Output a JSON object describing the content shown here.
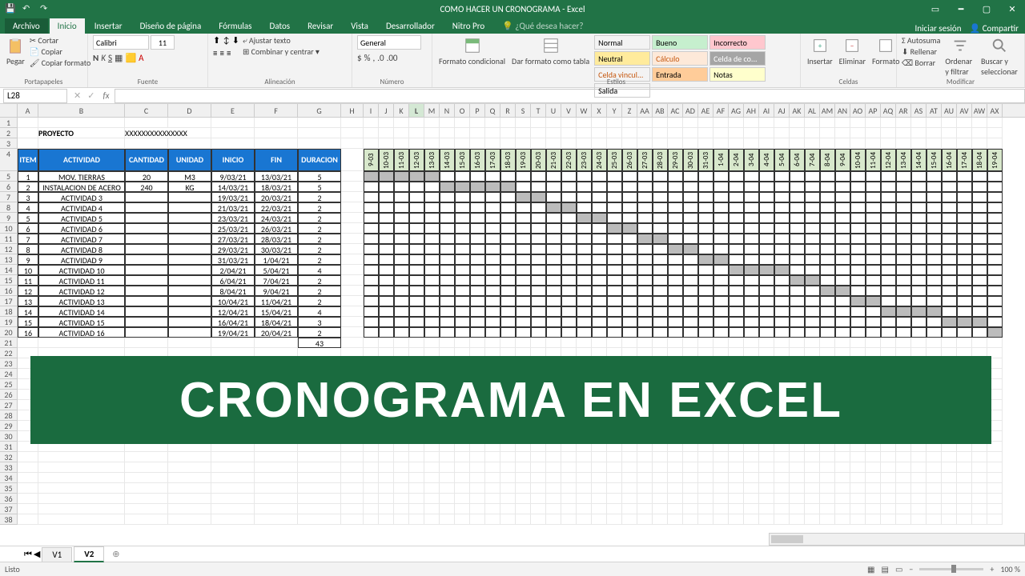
{
  "title": "COMO HACER UN CRONOGRAMA - Excel",
  "tabs": {
    "file": "Archivo",
    "home": "Inicio",
    "insert": "Insertar",
    "layout": "Diseño de página",
    "formulas": "Fórmulas",
    "data": "Datos",
    "review": "Revisar",
    "view": "Vista",
    "dev": "Desarrollador",
    "nitro": "Nitro Pro",
    "tellme": "¿Qué desea hacer?",
    "signin": "Iniciar sesión",
    "share": "Compartir"
  },
  "ribbon": {
    "clipboard": {
      "paste": "Pegar",
      "cut": "Cortar",
      "copy": "Copiar",
      "format_painter": "Copiar formato",
      "label": "Portapapeles"
    },
    "font": {
      "name": "Calibri",
      "size": "11",
      "label": "Fuente"
    },
    "align": {
      "wrap": "Ajustar texto",
      "merge": "Combinar y centrar",
      "label": "Alineación"
    },
    "number": {
      "format": "General",
      "label": "Número"
    },
    "styles": {
      "cond": "Formato condicional",
      "table": "Dar formato como tabla",
      "c1": "Normal",
      "c2": "Bueno",
      "c3": "Incorrecto",
      "c4": "Neutral",
      "c5": "Cálculo",
      "c6": "Celda de co...",
      "c7": "Celda vincul...",
      "c8": "Entrada",
      "c9": "Notas",
      "c10": "Salida",
      "label": "Estilos"
    },
    "cells": {
      "insert": "Insertar",
      "delete": "Eliminar",
      "format": "Formato",
      "label": "Celdas"
    },
    "editing": {
      "autosum": "Autosuma",
      "fill": "Rellenar",
      "clear": "Borrar",
      "sort": "Ordenar y filtrar",
      "find": "Buscar y seleccionar",
      "label": "Modificar"
    }
  },
  "namebox": "L28",
  "project": {
    "label": "PROYECTO",
    "value": "XXXXXXXXXXXXXXX"
  },
  "columns_main": [
    "A",
    "B",
    "C",
    "D",
    "E",
    "F",
    "G",
    "H"
  ],
  "columns_narrow": [
    "I",
    "J",
    "K",
    "L",
    "M",
    "N",
    "O",
    "P",
    "Q",
    "R",
    "S",
    "T",
    "U",
    "V",
    "W",
    "X",
    "Y",
    "Z",
    "AA",
    "AB",
    "AC",
    "AD",
    "AE",
    "AF",
    "AG",
    "AH",
    "AI",
    "AJ",
    "AK",
    "AL",
    "AM",
    "AN",
    "AO",
    "AP",
    "AQ",
    "AR",
    "AS",
    "AT",
    "AU",
    "AV",
    "AW",
    "AX"
  ],
  "headers": {
    "item": "ITEM",
    "actividad": "ACTIVIDAD",
    "cantidad": "CANTIDAD",
    "unidad": "UNIDAD",
    "inicio": "INICIO",
    "fin": "FIN",
    "duracion": "DURACION"
  },
  "dates": [
    "9-03",
    "10-03",
    "11-03",
    "12-03",
    "13-03",
    "14-03",
    "15-03",
    "16-03",
    "17-03",
    "18-03",
    "19-03",
    "20-03",
    "21-03",
    "22-03",
    "23-03",
    "24-03",
    "25-03",
    "26-03",
    "27-03",
    "28-03",
    "29-03",
    "30-03",
    "31-03",
    "1-04",
    "2-04",
    "3-04",
    "4-04",
    "5-04",
    "6-04",
    "7-04",
    "8-04",
    "9-04",
    "10-04",
    "11-04",
    "12-04",
    "13-04",
    "14-04",
    "15-04",
    "16-04",
    "17-04",
    "18-04",
    "19-04"
  ],
  "rows": [
    {
      "n": 1,
      "act": "MOV. TIERRAS",
      "cant": "20",
      "uni": "M3",
      "ini": "9/03/21",
      "fin": "13/03/21",
      "dur": "5",
      "g": [
        0,
        4
      ]
    },
    {
      "n": 2,
      "act": "INSTALACION DE ACERO",
      "cant": "240",
      "uni": "KG",
      "ini": "14/03/21",
      "fin": "18/03/21",
      "dur": "5",
      "g": [
        5,
        9
      ]
    },
    {
      "n": 3,
      "act": "ACTIVIDAD 3",
      "cant": "",
      "uni": "",
      "ini": "19/03/21",
      "fin": "20/03/21",
      "dur": "2",
      "g": [
        10,
        11
      ]
    },
    {
      "n": 4,
      "act": "ACTIVIDAD 4",
      "cant": "",
      "uni": "",
      "ini": "21/03/21",
      "fin": "22/03/21",
      "dur": "2",
      "g": [
        12,
        13
      ]
    },
    {
      "n": 5,
      "act": "ACTIVIDAD 5",
      "cant": "",
      "uni": "",
      "ini": "23/03/21",
      "fin": "24/03/21",
      "dur": "2",
      "g": [
        14,
        15
      ]
    },
    {
      "n": 6,
      "act": "ACTIVIDAD 6",
      "cant": "",
      "uni": "",
      "ini": "25/03/21",
      "fin": "26/03/21",
      "dur": "2",
      "g": [
        16,
        17
      ]
    },
    {
      "n": 7,
      "act": "ACTIVIDAD 7",
      "cant": "",
      "uni": "",
      "ini": "27/03/21",
      "fin": "28/03/21",
      "dur": "2",
      "g": [
        18,
        19
      ]
    },
    {
      "n": 8,
      "act": "ACTIVIDAD 8",
      "cant": "",
      "uni": "",
      "ini": "29/03/21",
      "fin": "30/03/21",
      "dur": "2",
      "g": [
        20,
        21
      ]
    },
    {
      "n": 9,
      "act": "ACTIVIDAD 9",
      "cant": "",
      "uni": "",
      "ini": "31/03/21",
      "fin": "1/04/21",
      "dur": "2",
      "g": [
        22,
        23
      ]
    },
    {
      "n": 10,
      "act": "ACTIVIDAD 10",
      "cant": "",
      "uni": "",
      "ini": "2/04/21",
      "fin": "5/04/21",
      "dur": "4",
      "g": [
        24,
        27
      ]
    },
    {
      "n": 11,
      "act": "ACTIVIDAD 11",
      "cant": "",
      "uni": "",
      "ini": "6/04/21",
      "fin": "7/04/21",
      "dur": "2",
      "g": [
        28,
        29
      ]
    },
    {
      "n": 12,
      "act": "ACTIVIDAD 12",
      "cant": "",
      "uni": "",
      "ini": "8/04/21",
      "fin": "9/04/21",
      "dur": "2",
      "g": [
        30,
        31
      ]
    },
    {
      "n": 13,
      "act": "ACTIVIDAD 13",
      "cant": "",
      "uni": "",
      "ini": "10/04/21",
      "fin": "11/04/21",
      "dur": "2",
      "g": [
        32,
        33
      ]
    },
    {
      "n": 14,
      "act": "ACTIVIDAD 14",
      "cant": "",
      "uni": "",
      "ini": "12/04/21",
      "fin": "15/04/21",
      "dur": "4",
      "g": [
        34,
        37
      ]
    },
    {
      "n": 15,
      "act": "ACTIVIDAD 15",
      "cant": "",
      "uni": "",
      "ini": "16/04/21",
      "fin": "18/04/21",
      "dur": "3",
      "g": [
        38,
        40
      ]
    },
    {
      "n": 16,
      "act": "ACTIVIDAD 16",
      "cant": "",
      "uni": "",
      "ini": "19/04/21",
      "fin": "20/04/21",
      "dur": "2",
      "g": [
        41,
        41
      ]
    }
  ],
  "total_dur": "43",
  "banner": "CRONOGRAMA EN EXCEL",
  "sheets": {
    "s1": "V1",
    "s2": "V2"
  },
  "status": {
    "ready": "Listo",
    "zoom": "100 %"
  },
  "colw": {
    "A": 26,
    "B": 108,
    "C": 54,
    "D": 54,
    "E": 54,
    "F": 54,
    "G": 54,
    "H": 28,
    "narrow": 19
  }
}
